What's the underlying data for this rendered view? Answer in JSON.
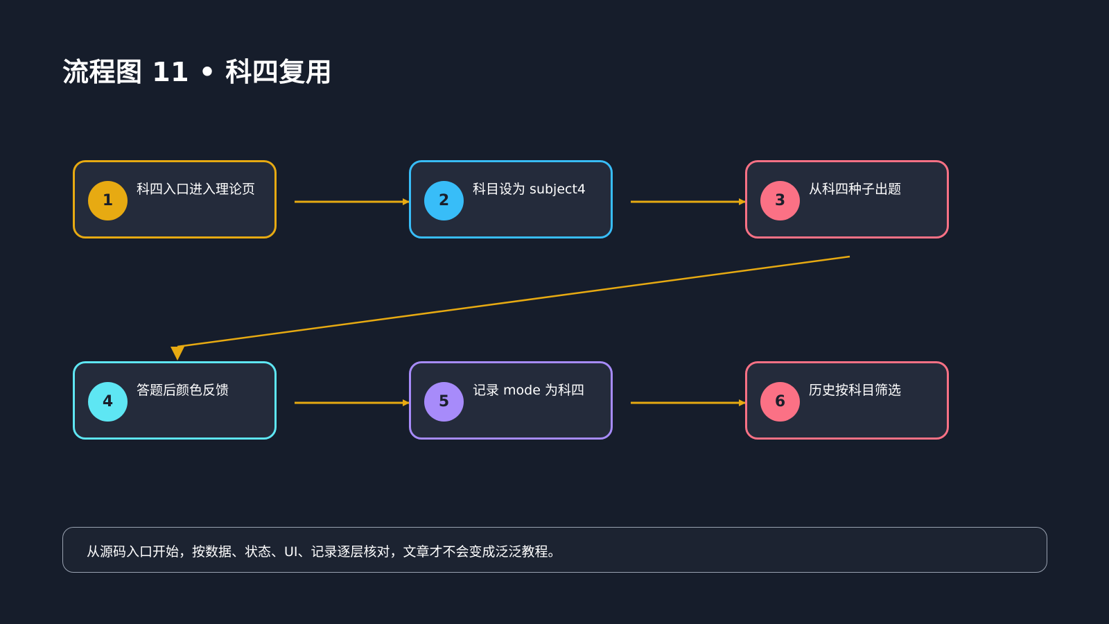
{
  "title": "流程图 11 • 科四复用",
  "colors": {
    "background": "#161d2b",
    "arrow": "#e7aa12"
  },
  "steps": [
    {
      "number": "1",
      "label": "科四入口进入理论页",
      "color": "#e7aa12"
    },
    {
      "number": "2",
      "label": "科目设为 subject4",
      "color": "#38bdf8"
    },
    {
      "number": "3",
      "label": "从科四种子出题",
      "color": "#fb7185"
    },
    {
      "number": "4",
      "label": "答题后颜色反馈",
      "color": "#5ee6f3"
    },
    {
      "number": "5",
      "label": "记录 mode 为科四",
      "color": "#a78bfa"
    },
    {
      "number": "6",
      "label": "历史按科目筛选",
      "color": "#fb7185"
    }
  ],
  "footer": {
    "note": "从源码入口开始，按数据、状态、UI、记录逐层核对，文章才不会变成泛泛教程。"
  }
}
